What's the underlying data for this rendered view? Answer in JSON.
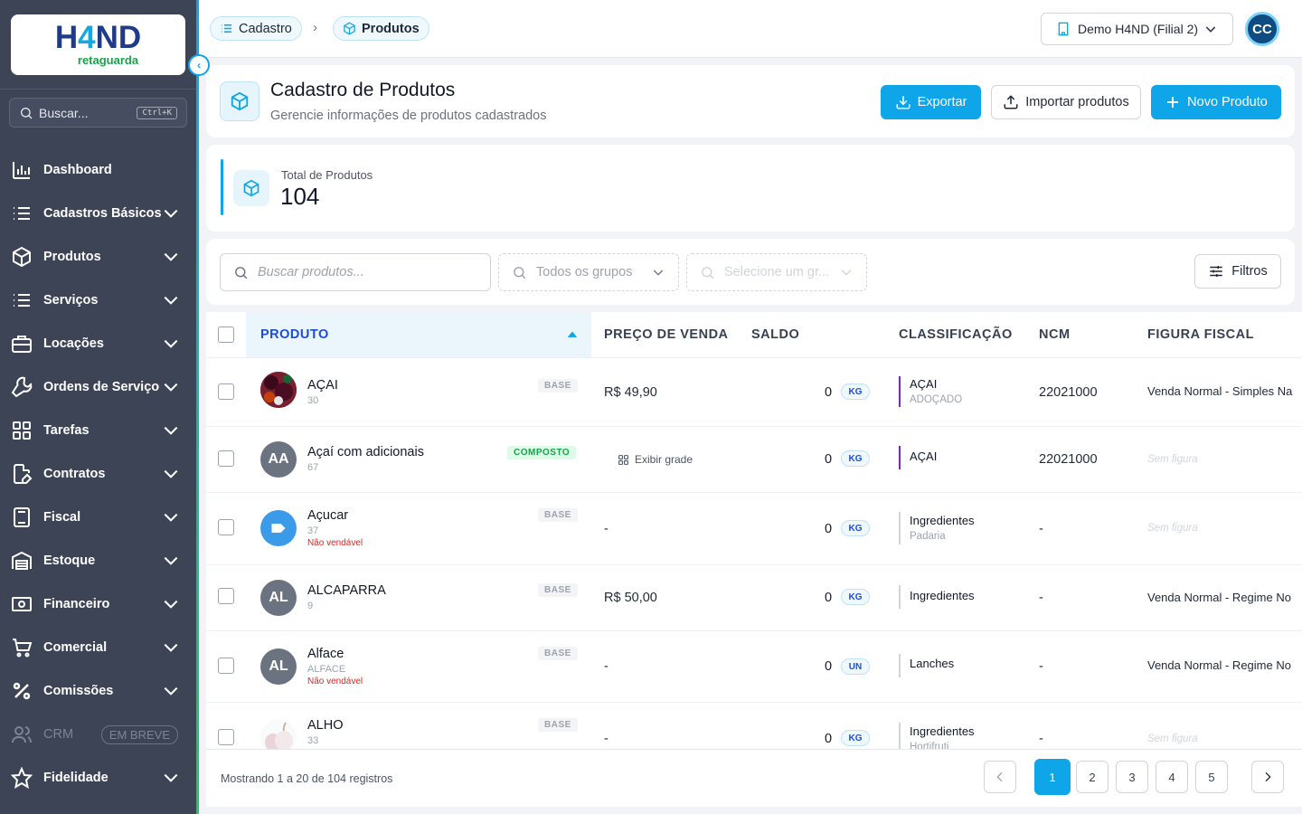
{
  "brand": {
    "logo_main_a": "H",
    "logo_main_b": "4",
    "logo_main_c": "ND",
    "logo_sub": "retaguarda"
  },
  "sidebar": {
    "search_placeholder": "Buscar...",
    "search_shortcut": "Ctrl+K",
    "items": [
      {
        "label": "Dashboard",
        "icon": "chart-icon"
      },
      {
        "label": "Cadastros Básicos",
        "icon": "list-icon"
      },
      {
        "label": "Produtos",
        "icon": "box-icon"
      },
      {
        "label": "Serviços",
        "icon": "list-icon"
      },
      {
        "label": "Locações",
        "icon": "briefcase-icon"
      },
      {
        "label": "Ordens de Serviço",
        "icon": "wrench-icon"
      },
      {
        "label": "Tarefas",
        "icon": "grid-icon"
      },
      {
        "label": "Contratos",
        "icon": "document-pen-icon"
      },
      {
        "label": "Fiscal",
        "icon": "calculator-icon"
      },
      {
        "label": "Estoque",
        "icon": "warehouse-icon"
      },
      {
        "label": "Financeiro",
        "icon": "money-icon"
      },
      {
        "label": "Comercial",
        "icon": "cart-icon"
      },
      {
        "label": "Comissões",
        "icon": "percent-icon"
      },
      {
        "label": "CRM",
        "icon": "users-icon",
        "badge": "EM BREVE"
      },
      {
        "label": "Fidelidade",
        "icon": "star-icon"
      }
    ]
  },
  "topbar": {
    "breadcrumb": [
      "Cadastro",
      "Produtos"
    ],
    "store": "Demo H4ND (Filial 2)",
    "avatar": "CC"
  },
  "header": {
    "title": "Cadastro de Produtos",
    "subtitle": "Gerencie informações de produtos cadastrados",
    "export_label": "Exportar",
    "import_label": "Importar produtos",
    "new_label": "Novo Produto"
  },
  "stats": {
    "label": "Total de Produtos",
    "value": "104"
  },
  "filters": {
    "search_placeholder": "Buscar produtos...",
    "groups_placeholder": "Todos os grupos",
    "subgroup_placeholder": "Selecione um gr...",
    "filters_label": "Filtros"
  },
  "table": {
    "columns": [
      "PRODUTO",
      "PREÇO DE VENDA",
      "SALDO",
      "CLASSIFICAÇÃO",
      "NCM",
      "FIGURA FISCAL"
    ],
    "rows": [
      {
        "name": "AÇAI",
        "code": "30",
        "not_sellable": "",
        "badge": "BASE",
        "price": "R$ 49,90",
        "saldo": "0",
        "unit": "KG",
        "class_main": "AÇAI",
        "class_sub": "ADOÇADO",
        "class_color": "#7e22ce",
        "ncm": "22021000",
        "figura": "Venda Normal - Simples Na",
        "thumb_text": "",
        "thumb_kind": "acai"
      },
      {
        "name": "Açaí com adicionais",
        "code": "67",
        "not_sellable": "",
        "badge": "COMPOSTO",
        "price": "Exibir grade",
        "saldo": "0",
        "unit": "KG",
        "class_main": "AÇAI",
        "class_sub": "",
        "class_color": "#7e22ce",
        "ncm": "22021000",
        "figura": "Sem figura",
        "thumb_text": "AA",
        "thumb_kind": "initials"
      },
      {
        "name": "Açucar",
        "code": "37",
        "not_sellable": "Não vendável",
        "badge": "BASE",
        "price": "-",
        "saldo": "0",
        "unit": "KG",
        "class_main": "Ingredientes",
        "class_sub": "Padaria",
        "class_color": "#d1d5db",
        "ncm": "-",
        "figura": "Sem figura",
        "thumb_text": "",
        "thumb_kind": "tag"
      },
      {
        "name": "ALCAPARRA",
        "code": "9",
        "not_sellable": "",
        "badge": "BASE",
        "price": "R$ 50,00",
        "saldo": "0",
        "unit": "KG",
        "class_main": "Ingredientes",
        "class_sub": "",
        "class_color": "#d1d5db",
        "ncm": "-",
        "figura": "Venda Normal - Regime No",
        "thumb_text": "AL",
        "thumb_kind": "initials"
      },
      {
        "name": "Alface",
        "code": "ALFACE",
        "not_sellable": "Não vendável",
        "badge": "BASE",
        "price": "-",
        "saldo": "0",
        "unit": "UN",
        "class_main": "Lanches",
        "class_sub": "",
        "class_color": "#d1d5db",
        "ncm": "-",
        "figura": "Venda Normal - Regime No",
        "thumb_text": "AL",
        "thumb_kind": "initials"
      },
      {
        "name": "ALHO",
        "code": "33",
        "not_sellable": "",
        "badge": "BASE",
        "price": "-",
        "saldo": "0",
        "unit": "KG",
        "class_main": "Ingredientes",
        "class_sub": "Hortifruti",
        "class_color": "#d1d5db",
        "ncm": "-",
        "figura": "Sem figura",
        "thumb_text": "",
        "thumb_kind": "garlic"
      }
    ]
  },
  "footer": {
    "showing": "Mostrando 1 a 20 de 104 registros",
    "pages": [
      "1",
      "2",
      "3",
      "4",
      "5"
    ],
    "current_page": "1"
  },
  "colors": {
    "accent": "#0ea5e9",
    "sidebar": "#3d4456",
    "brand_dark": "#1e3a8a",
    "brand_green": "#16a34a"
  }
}
